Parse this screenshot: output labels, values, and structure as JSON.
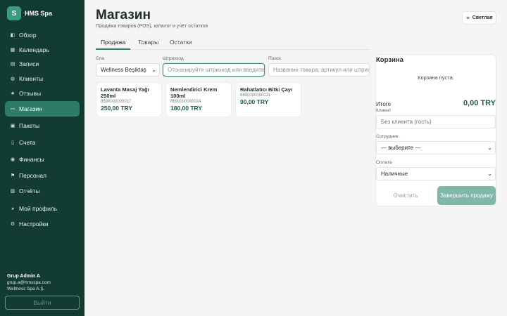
{
  "brand": {
    "logo_letter": "S",
    "name": "HMS Spa"
  },
  "nav": [
    {
      "icon": "overview-icon",
      "glyph": "◧",
      "label": "Обзор"
    },
    {
      "icon": "calendar-icon",
      "glyph": "▦",
      "label": "Календарь"
    },
    {
      "icon": "records-icon",
      "glyph": "▤",
      "label": "Записи"
    },
    {
      "icon": "clients-icon",
      "glyph": "◍",
      "label": "Клиенты"
    },
    {
      "icon": "star-icon",
      "glyph": "★",
      "label": "Отзывы"
    },
    {
      "icon": "shop-icon",
      "glyph": "▭",
      "label": "Магазин",
      "active": true
    },
    {
      "icon": "package-icon",
      "glyph": "▣",
      "label": "Пакеты"
    },
    {
      "icon": "invoice-icon",
      "glyph": "▯",
      "label": "Счета"
    },
    {
      "icon": "money-bag-icon",
      "glyph": "◉",
      "label": "Финансы"
    },
    {
      "icon": "staff-icon",
      "glyph": "⚑",
      "label": "Персонал"
    },
    {
      "icon": "reports-icon",
      "glyph": "▥",
      "label": "Отчёты"
    },
    {
      "icon": "profile-icon",
      "glyph": "◕",
      "label": "Мой профиль"
    },
    {
      "icon": "gear-icon",
      "glyph": "⚙",
      "label": "Настройки"
    }
  ],
  "user": {
    "name": "Grup Admin A",
    "email": "grup.a@hmsspa.com",
    "company": "Wellness Spa A.Ş."
  },
  "logout_label": "Выйти",
  "header": {
    "title": "Магазин",
    "subtitle": "Продажа товаров (POS), каталог и учёт остатков",
    "theme_icon": "sun-icon",
    "theme_glyph": "☀",
    "theme_label": "Светлая"
  },
  "tabs": [
    {
      "label": "Продажа",
      "active": true
    },
    {
      "label": "Товары"
    },
    {
      "label": "Остатки"
    }
  ],
  "filters": {
    "spa_label": "Спа",
    "spa_value": "Wellness Beşiktaş",
    "barcode_label": "Штрихкод",
    "barcode_placeholder": "Отсканируйте штрихкод или введите",
    "search_label": "Поиск",
    "search_placeholder": "Название товара, артикул или штрихкод"
  },
  "products": [
    {
      "name": "Lavanta Masaj Yağı 250ml",
      "sku": "8690000000017",
      "price": "250,00 TRY"
    },
    {
      "name": "Nemlendirici Krem 100ml",
      "sku": "8690000000024",
      "price": "180,00 TRY"
    },
    {
      "name": "Rahatlatıcı Bitki Çayı",
      "sku": "8690000000031",
      "price": "90,00 TRY"
    }
  ],
  "cart": {
    "title": "Корзина",
    "empty_text": "Корзина пуста.",
    "total_label": "Итого",
    "total_value": "0,00 TRY",
    "client_label": "Клиент",
    "client_placeholder": "Без клиента (гость)",
    "employee_label": "Сотрудник",
    "employee_value": "— выберите —",
    "payment_label": "Оплата",
    "payment_value": "Наличные",
    "clear_label": "Очистить",
    "finish_label": "Завершить продажу"
  }
}
